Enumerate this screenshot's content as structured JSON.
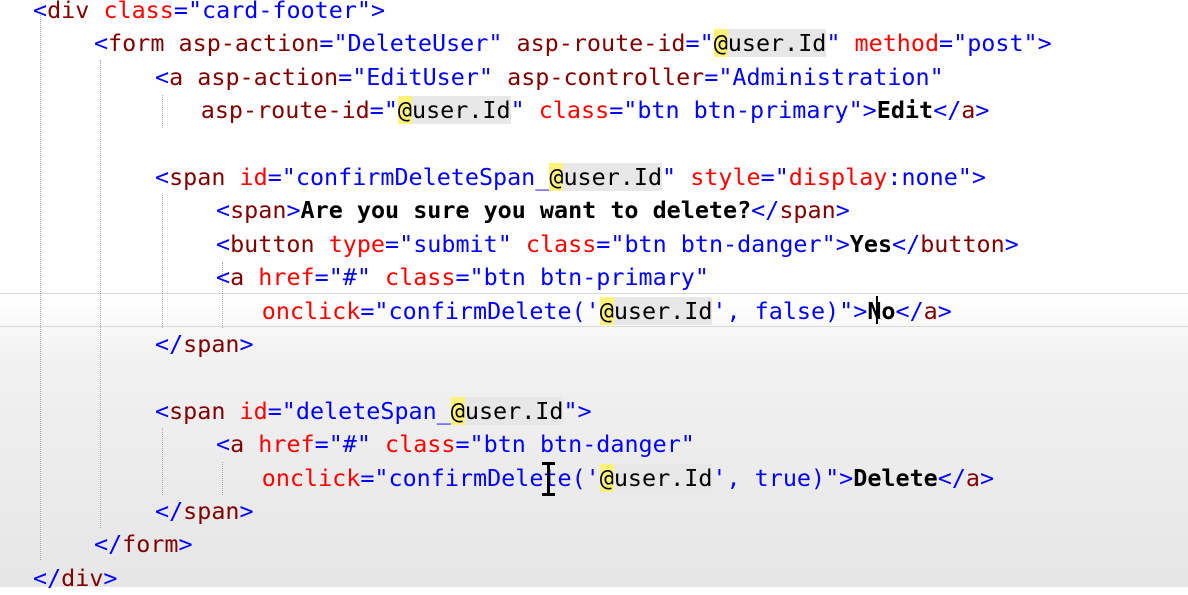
{
  "editor": {
    "lines": [
      {
        "indent": 0,
        "tokens": [
          {
            "t": "<",
            "c": "plain"
          },
          {
            "t": "div",
            "c": "tag"
          },
          {
            "t": " ",
            "c": "plain"
          },
          {
            "t": "class",
            "c": "attr"
          },
          {
            "t": "=\"card-footer\"",
            "c": "str"
          },
          {
            "t": ">",
            "c": "plain"
          }
        ]
      },
      {
        "indent": 1,
        "tokens": [
          {
            "t": "<",
            "c": "plain"
          },
          {
            "t": "form",
            "c": "tag"
          },
          {
            "t": " ",
            "c": "plain"
          },
          {
            "t": "asp-action",
            "c": "tag"
          },
          {
            "t": "=\"DeleteUser\" ",
            "c": "str"
          },
          {
            "t": "asp-route-id",
            "c": "tag"
          },
          {
            "t": "=\"",
            "c": "str"
          },
          {
            "t": "@",
            "c": "razor"
          },
          {
            "t": "user.Id",
            "c": "uid hl-gray"
          },
          {
            "t": "\" ",
            "c": "str"
          },
          {
            "t": "method",
            "c": "attr"
          },
          {
            "t": "=\"post\"",
            "c": "str"
          },
          {
            "t": ">",
            "c": "plain"
          }
        ]
      },
      {
        "indent": 2,
        "tokens": [
          {
            "t": "<",
            "c": "plain"
          },
          {
            "t": "a",
            "c": "tag"
          },
          {
            "t": " ",
            "c": "plain"
          },
          {
            "t": "asp-action",
            "c": "tag"
          },
          {
            "t": "=\"EditUser\" ",
            "c": "str"
          },
          {
            "t": "asp-controller",
            "c": "tag"
          },
          {
            "t": "=\"Administration\"",
            "c": "str"
          }
        ]
      },
      {
        "indent": 2.75,
        "tokens": [
          {
            "t": "asp-route-id",
            "c": "tag"
          },
          {
            "t": "=\"",
            "c": "str"
          },
          {
            "t": "@",
            "c": "razor"
          },
          {
            "t": "user.Id",
            "c": "uid hl-gray"
          },
          {
            "t": "\" ",
            "c": "str"
          },
          {
            "t": "class",
            "c": "attr"
          },
          {
            "t": "=\"btn btn-primary\"",
            "c": "str"
          },
          {
            "t": ">",
            "c": "plain"
          },
          {
            "t": "Edit",
            "c": "text"
          },
          {
            "t": "</",
            "c": "plain"
          },
          {
            "t": "a",
            "c": "tag"
          },
          {
            "t": ">",
            "c": "plain"
          }
        ]
      },
      {
        "indent": 0,
        "tokens": []
      },
      {
        "indent": 2,
        "tokens": [
          {
            "t": "<",
            "c": "plain"
          },
          {
            "t": "span",
            "c": "tag"
          },
          {
            "t": " ",
            "c": "plain"
          },
          {
            "t": "id",
            "c": "attr"
          },
          {
            "t": "=\"confirmDeleteSpan_",
            "c": "str"
          },
          {
            "t": "@",
            "c": "razor"
          },
          {
            "t": "user.Id",
            "c": "uid hl-gray"
          },
          {
            "t": "\" ",
            "c": "str"
          },
          {
            "t": "style",
            "c": "attr"
          },
          {
            "t": "=\"",
            "c": "str"
          },
          {
            "t": "display",
            "c": "attr"
          },
          {
            "t": ":none\"",
            "c": "str"
          },
          {
            "t": ">",
            "c": "plain"
          }
        ]
      },
      {
        "indent": 3,
        "tokens": [
          {
            "t": "<",
            "c": "plain"
          },
          {
            "t": "span",
            "c": "tag"
          },
          {
            "t": ">",
            "c": "plain"
          },
          {
            "t": "Are you sure you want to delete?",
            "c": "text"
          },
          {
            "t": "</",
            "c": "plain"
          },
          {
            "t": "span",
            "c": "tag"
          },
          {
            "t": ">",
            "c": "plain"
          }
        ]
      },
      {
        "indent": 3,
        "tokens": [
          {
            "t": "<",
            "c": "plain"
          },
          {
            "t": "button",
            "c": "tag"
          },
          {
            "t": " ",
            "c": "plain"
          },
          {
            "t": "type",
            "c": "attr"
          },
          {
            "t": "=\"submit\" ",
            "c": "str"
          },
          {
            "t": "class",
            "c": "attr"
          },
          {
            "t": "=\"btn btn-danger\"",
            "c": "str"
          },
          {
            "t": ">",
            "c": "plain"
          },
          {
            "t": "Yes",
            "c": "text"
          },
          {
            "t": "</",
            "c": "plain"
          },
          {
            "t": "button",
            "c": "tag"
          },
          {
            "t": ">",
            "c": "plain"
          }
        ]
      },
      {
        "indent": 3,
        "tokens": [
          {
            "t": "<",
            "c": "plain"
          },
          {
            "t": "a",
            "c": "tag"
          },
          {
            "t": " ",
            "c": "plain"
          },
          {
            "t": "href",
            "c": "attr"
          },
          {
            "t": "=\"#\" ",
            "c": "str"
          },
          {
            "t": "class",
            "c": "attr"
          },
          {
            "t": "=\"btn btn-primary\"",
            "c": "str"
          }
        ]
      },
      {
        "indent": 3.75,
        "tokens": [
          {
            "t": "onclick",
            "c": "attr"
          },
          {
            "t": "=\"confirmDelete('",
            "c": "str"
          },
          {
            "t": "@",
            "c": "razor"
          },
          {
            "t": "user.Id",
            "c": "uid hl-gray"
          },
          {
            "t": "', false)\"",
            "c": "str"
          },
          {
            "t": ">",
            "c": "plain"
          },
          {
            "t": "No",
            "c": "text"
          },
          {
            "t": "</",
            "c": "plain"
          },
          {
            "t": "a",
            "c": "tag"
          },
          {
            "t": ">",
            "c": "plain"
          }
        ]
      },
      {
        "indent": 2,
        "tokens": [
          {
            "t": "</",
            "c": "plain"
          },
          {
            "t": "span",
            "c": "tag"
          },
          {
            "t": ">",
            "c": "plain"
          }
        ]
      },
      {
        "indent": 0,
        "tokens": []
      },
      {
        "indent": 2,
        "tokens": [
          {
            "t": "<",
            "c": "plain"
          },
          {
            "t": "span",
            "c": "tag"
          },
          {
            "t": " ",
            "c": "plain"
          },
          {
            "t": "id",
            "c": "attr"
          },
          {
            "t": "=\"deleteSpan_",
            "c": "str"
          },
          {
            "t": "@",
            "c": "razor"
          },
          {
            "t": "user.Id",
            "c": "uid hl-gray"
          },
          {
            "t": "\"",
            "c": "str"
          },
          {
            "t": ">",
            "c": "plain"
          }
        ]
      },
      {
        "indent": 3,
        "tokens": [
          {
            "t": "<",
            "c": "plain"
          },
          {
            "t": "a",
            "c": "tag"
          },
          {
            "t": " ",
            "c": "plain"
          },
          {
            "t": "href",
            "c": "attr"
          },
          {
            "t": "=\"#\" ",
            "c": "str"
          },
          {
            "t": "class",
            "c": "attr"
          },
          {
            "t": "=\"btn btn-danger\"",
            "c": "str"
          }
        ]
      },
      {
        "indent": 3.75,
        "tokens": [
          {
            "t": "onclick",
            "c": "attr"
          },
          {
            "t": "=\"confirmDelete('",
            "c": "str"
          },
          {
            "t": "@",
            "c": "razor"
          },
          {
            "t": "user.Id",
            "c": "uid hl-gray"
          },
          {
            "t": "', true)\"",
            "c": "str"
          },
          {
            "t": ">",
            "c": "plain"
          },
          {
            "t": "Delete",
            "c": "text"
          },
          {
            "t": "</",
            "c": "plain"
          },
          {
            "t": "a",
            "c": "tag"
          },
          {
            "t": ">",
            "c": "plain"
          }
        ]
      },
      {
        "indent": 2,
        "tokens": [
          {
            "t": "</",
            "c": "plain"
          },
          {
            "t": "span",
            "c": "tag"
          },
          {
            "t": ">",
            "c": "plain"
          }
        ]
      },
      {
        "indent": 1,
        "tokens": [
          {
            "t": "</",
            "c": "plain"
          },
          {
            "t": "form",
            "c": "tag"
          },
          {
            "t": ">",
            "c": "plain"
          }
        ]
      },
      {
        "indent": 0,
        "tokens": [
          {
            "t": "</",
            "c": "plain"
          },
          {
            "t": "div",
            "c": "tag"
          },
          {
            "t": ">",
            "c": "plain"
          }
        ]
      }
    ],
    "colors": {
      "tag": "#800000",
      "attribute": "#ff0000",
      "string": "#0000ff",
      "punctuation": "#0000ff",
      "razor_highlight": "#fff27a",
      "text": "#000000"
    }
  },
  "cursor": {
    "caret_line": 10,
    "mouse_pointer": "i-beam-cursor-icon"
  }
}
